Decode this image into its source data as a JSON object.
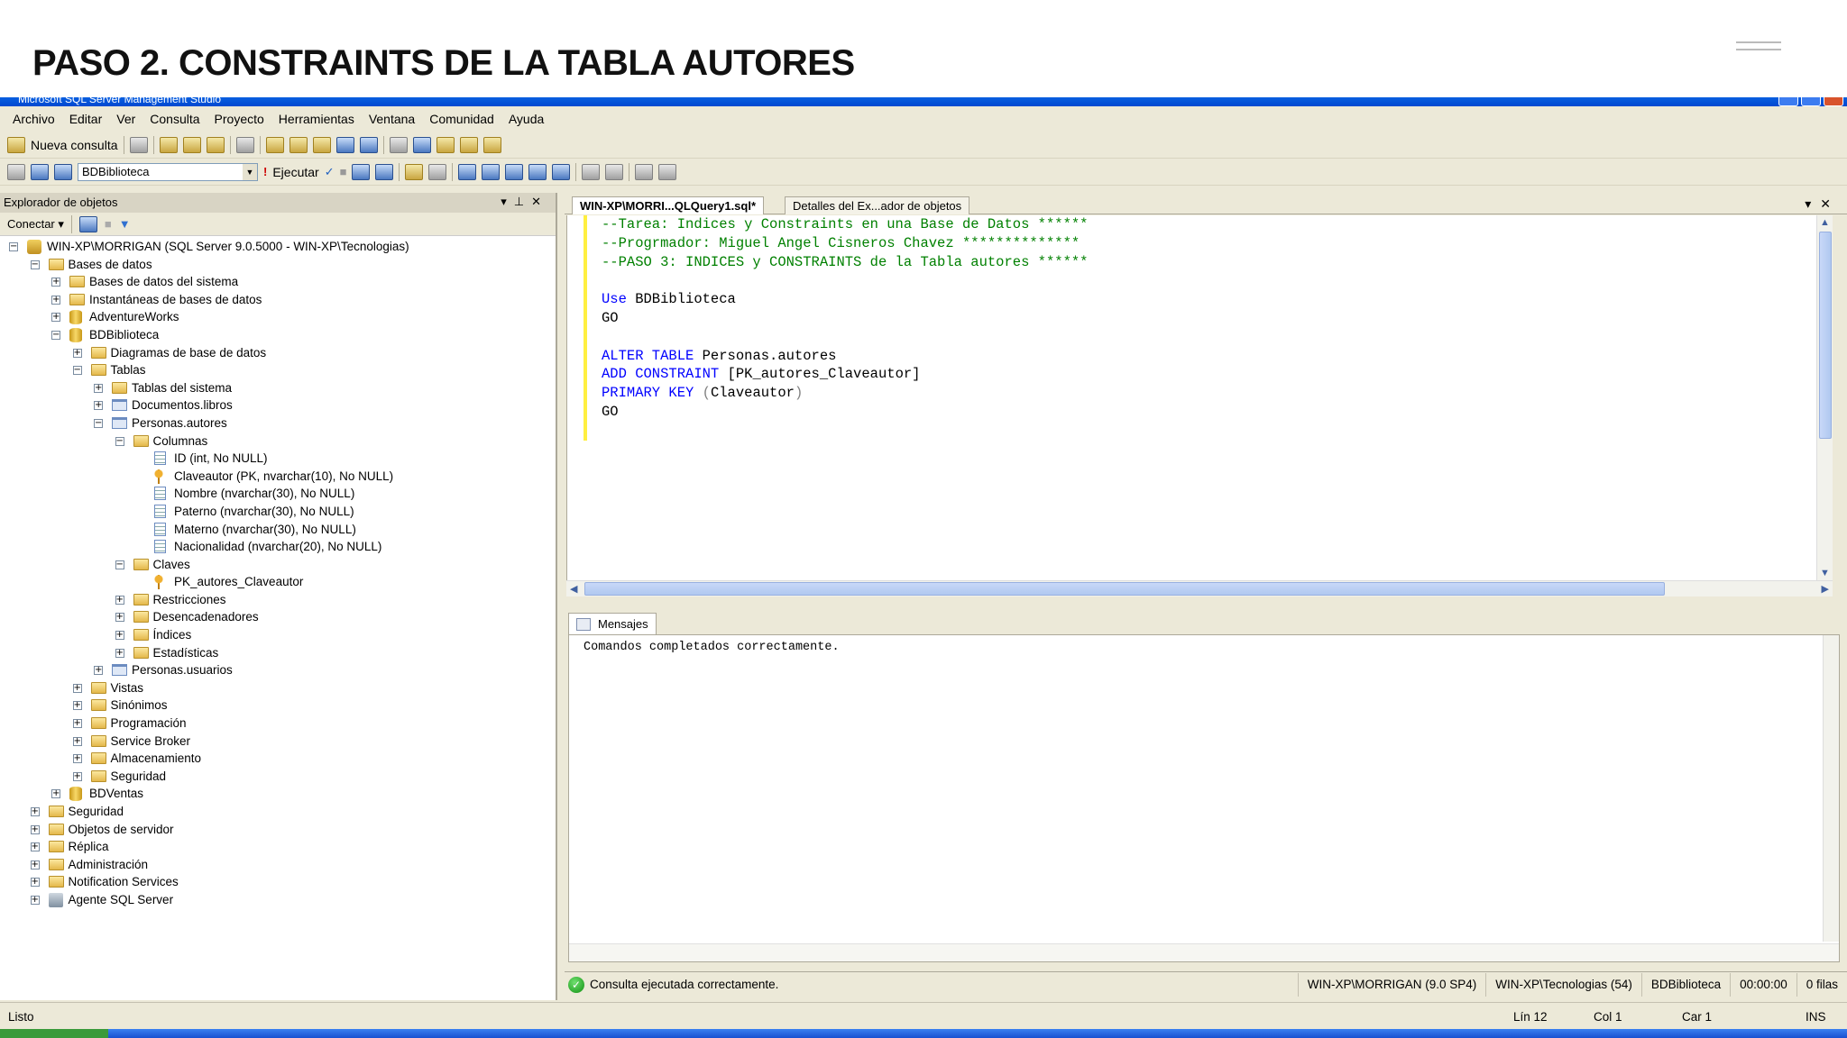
{
  "slide": {
    "title": "PASO 2. CONSTRAINTS DE LA TABLA AUTORES"
  },
  "window": {
    "title": "Microsoft SQL Server Management Studio"
  },
  "menu": [
    "Archivo",
    "Editar",
    "Ver",
    "Consulta",
    "Proyecto",
    "Herramientas",
    "Ventana",
    "Comunidad",
    "Ayuda"
  ],
  "toolbar": {
    "new_query": "Nueva consulta",
    "database": "BDBiblioteca",
    "execute": "Ejecutar"
  },
  "explorer": {
    "title": "Explorador de objetos",
    "connect": "Conectar",
    "tree": [
      {
        "level": 0,
        "exp": "-",
        "icon": "server",
        "label": "WIN-XP\\MORRIGAN (SQL Server 9.0.5000 - WIN-XP\\Tecnologias)"
      },
      {
        "level": 1,
        "exp": "-",
        "icon": "folder",
        "label": "Bases de datos"
      },
      {
        "level": 2,
        "exp": "+",
        "icon": "folder",
        "label": "Bases de datos del sistema"
      },
      {
        "level": 2,
        "exp": "+",
        "icon": "folder",
        "label": "Instantáneas de bases de datos"
      },
      {
        "level": 2,
        "exp": "+",
        "icon": "db",
        "label": "AdventureWorks"
      },
      {
        "level": 2,
        "exp": "-",
        "icon": "db",
        "label": "BDBiblioteca"
      },
      {
        "level": 3,
        "exp": "+",
        "icon": "folder",
        "label": "Diagramas de base de datos"
      },
      {
        "level": 3,
        "exp": "-",
        "icon": "folder",
        "label": "Tablas"
      },
      {
        "level": 4,
        "exp": "+",
        "icon": "folder",
        "label": "Tablas del sistema"
      },
      {
        "level": 4,
        "exp": "+",
        "icon": "table",
        "label": "Documentos.libros"
      },
      {
        "level": 4,
        "exp": "-",
        "icon": "table",
        "label": "Personas.autores"
      },
      {
        "level": 5,
        "exp": "-",
        "icon": "folder",
        "label": "Columnas"
      },
      {
        "level": 6,
        "exp": "",
        "icon": "column",
        "label": "ID (int, No NULL)"
      },
      {
        "level": 6,
        "exp": "",
        "icon": "key",
        "label": "Claveautor (PK, nvarchar(10), No NULL)"
      },
      {
        "level": 6,
        "exp": "",
        "icon": "column",
        "label": "Nombre (nvarchar(30), No NULL)"
      },
      {
        "level": 6,
        "exp": "",
        "icon": "column",
        "label": "Paterno (nvarchar(30), No NULL)"
      },
      {
        "level": 6,
        "exp": "",
        "icon": "column",
        "label": "Materno (nvarchar(30), No NULL)"
      },
      {
        "level": 6,
        "exp": "",
        "icon": "column",
        "label": "Nacionalidad (nvarchar(20), No NULL)"
      },
      {
        "level": 5,
        "exp": "-",
        "icon": "folder",
        "label": "Claves"
      },
      {
        "level": 6,
        "exp": "",
        "icon": "key",
        "label": "PK_autores_Claveautor"
      },
      {
        "level": 5,
        "exp": "+",
        "icon": "folder",
        "label": "Restricciones"
      },
      {
        "level": 5,
        "exp": "+",
        "icon": "folder",
        "label": "Desencadenadores"
      },
      {
        "level": 5,
        "exp": "+",
        "icon": "folder",
        "label": "Índices"
      },
      {
        "level": 5,
        "exp": "+",
        "icon": "folder",
        "label": "Estadísticas"
      },
      {
        "level": 4,
        "exp": "+",
        "icon": "table",
        "label": "Personas.usuarios"
      },
      {
        "level": 3,
        "exp": "+",
        "icon": "folder",
        "label": "Vistas"
      },
      {
        "level": 3,
        "exp": "+",
        "icon": "folder",
        "label": "Sinónimos"
      },
      {
        "level": 3,
        "exp": "+",
        "icon": "folder",
        "label": "Programación"
      },
      {
        "level": 3,
        "exp": "+",
        "icon": "folder",
        "label": "Service Broker"
      },
      {
        "level": 3,
        "exp": "+",
        "icon": "folder",
        "label": "Almacenamiento"
      },
      {
        "level": 3,
        "exp": "+",
        "icon": "folder",
        "label": "Seguridad"
      },
      {
        "level": 2,
        "exp": "+",
        "icon": "db",
        "label": "BDVentas"
      },
      {
        "level": 1,
        "exp": "+",
        "icon": "folder",
        "label": "Seguridad"
      },
      {
        "level": 1,
        "exp": "+",
        "icon": "folder",
        "label": "Objetos de servidor"
      },
      {
        "level": 1,
        "exp": "+",
        "icon": "folder",
        "label": "Réplica"
      },
      {
        "level": 1,
        "exp": "+",
        "icon": "folder",
        "label": "Administración"
      },
      {
        "level": 1,
        "exp": "+",
        "icon": "folder",
        "label": "Notification Services"
      },
      {
        "level": 1,
        "exp": "+",
        "icon": "agent",
        "label": "Agente SQL Server"
      }
    ]
  },
  "editor": {
    "tabs": [
      "WIN-XP\\MORRI...QLQuery1.sql*",
      "Detalles del Ex...ador de objetos"
    ],
    "lines": [
      [
        {
          "c": "cm",
          "t": "--Tarea: Indices y Constraints en una Base de Datos ******"
        }
      ],
      [
        {
          "c": "cm",
          "t": "--Progrmador: Miguel Angel Cisneros Chavez **************"
        }
      ],
      [
        {
          "c": "cm",
          "t": "--PASO 3: INDICES y CONSTRAINTS de la Tabla autores ******"
        }
      ],
      [],
      [
        {
          "c": "kw",
          "t": "Use"
        },
        {
          "c": "",
          "t": " BDBiblioteca"
        }
      ],
      [
        {
          "c": "",
          "t": "GO"
        }
      ],
      [],
      [
        {
          "c": "kw",
          "t": "ALTER TABLE"
        },
        {
          "c": "",
          "t": " Personas.autores"
        }
      ],
      [
        {
          "c": "kw",
          "t": "ADD CONSTRAINT"
        },
        {
          "c": "",
          "t": " [PK_autores_Claveautor]"
        }
      ],
      [
        {
          "c": "kw",
          "t": "PRIMARY KEY"
        },
        {
          "c": "gr",
          "t": " ("
        },
        {
          "c": "",
          "t": "Claveautor"
        },
        {
          "c": "gr",
          "t": ")"
        }
      ],
      [
        {
          "c": "",
          "t": "GO"
        }
      ]
    ]
  },
  "messages": {
    "tab": "Mensajes",
    "text": "Comandos completados correctamente."
  },
  "query_status": {
    "message": "Consulta ejecutada correctamente.",
    "server": "WIN-XP\\MORRIGAN (9.0 SP4)",
    "user": "WIN-XP\\Tecnologias (54)",
    "database": "BDBiblioteca",
    "time": "00:00:00",
    "rows": "0 filas"
  },
  "status": {
    "ready": "Listo",
    "line": "Lín 12",
    "col": "Col 1",
    "char": "Car 1",
    "mode": "INS"
  }
}
